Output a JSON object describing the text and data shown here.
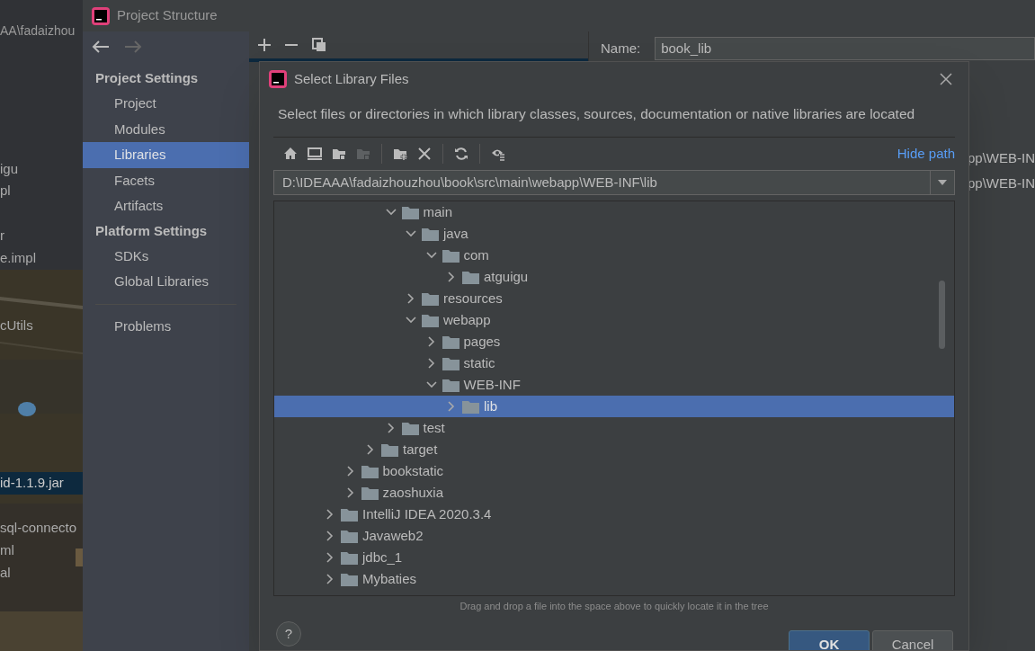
{
  "background_ide": {
    "path_text": "AA\\fadaizhou",
    "items": [
      {
        "label": "igu",
        "selected": false
      },
      {
        "label": "pl",
        "selected": false
      },
      {
        "label": "r",
        "selected": false
      },
      {
        "label": "e.impl",
        "selected": false
      },
      {
        "label": "cUtils",
        "selected": false
      },
      {
        "label": "id-1.1.9.jar",
        "selected": true
      },
      {
        "label": "sql-connecto",
        "selected": false
      },
      {
        "label": "ml",
        "selected": false
      },
      {
        "label": "al",
        "selected": false
      }
    ]
  },
  "window": {
    "title": "Project Structure"
  },
  "sidebar": {
    "sections": [
      {
        "header": "Project Settings",
        "items": [
          {
            "label": "Project",
            "selected": false
          },
          {
            "label": "Modules",
            "selected": false
          },
          {
            "label": "Libraries",
            "selected": true
          },
          {
            "label": "Facets",
            "selected": false
          },
          {
            "label": "Artifacts",
            "selected": false
          }
        ]
      },
      {
        "header": "Platform Settings",
        "items": [
          {
            "label": "SDKs",
            "selected": false
          },
          {
            "label": "Global Libraries",
            "selected": false
          }
        ]
      },
      {
        "items": [
          {
            "label": "Problems",
            "selected": false
          }
        ]
      }
    ]
  },
  "library_panel": {
    "name_label": "Name:",
    "name_value": "book_lib",
    "paths": [
      "pp\\WEB-IN",
      "pp\\WEB-IN"
    ]
  },
  "dialog": {
    "title": "Select Library Files",
    "description": "Select files or directories in which library classes, sources, documentation or native libraries are located",
    "toolbar": [
      {
        "kind": "home",
        "disabled": false
      },
      {
        "kind": "desktop",
        "disabled": false
      },
      {
        "kind": "project",
        "disabled": false
      },
      {
        "kind": "module",
        "disabled": true
      },
      {
        "kind": "separator"
      },
      {
        "kind": "new-folder",
        "disabled": false
      },
      {
        "kind": "delete",
        "disabled": false
      },
      {
        "kind": "separator"
      },
      {
        "kind": "refresh",
        "disabled": false
      },
      {
        "kind": "separator"
      },
      {
        "kind": "show-hidden",
        "disabled": false
      }
    ],
    "hide_path_link": "Hide path",
    "path": "D:\\IDEAAA\\fadaizhouzhou\\book\\src\\main\\webapp\\WEB-INF\\lib",
    "tree": [
      {
        "children": [
          {
            "children": [
              {
                "children": [
                  {
                    "label": "main",
                    "expanded": true,
                    "selected": false,
                    "children": [
                      {
                        "label": "java",
                        "expanded": true,
                        "selected": false,
                        "children": [
                          {
                            "label": "com",
                            "expanded": true,
                            "selected": false,
                            "children": [
                              {
                                "label": "atguigu",
                                "expanded": false,
                                "selected": false
                              }
                            ]
                          }
                        ]
                      },
                      {
                        "label": "resources",
                        "expanded": false,
                        "selected": false
                      },
                      {
                        "label": "webapp",
                        "expanded": true,
                        "selected": false,
                        "children": [
                          {
                            "label": "pages",
                            "expanded": false,
                            "selected": false
                          },
                          {
                            "label": "static",
                            "expanded": false,
                            "selected": false
                          },
                          {
                            "label": "WEB-INF",
                            "expanded": true,
                            "selected": false,
                            "children": [
                              {
                                "label": "lib",
                                "expanded": false,
                                "selected": true
                              }
                            ]
                          }
                        ]
                      }
                    ]
                  },
                  {
                    "label": "test",
                    "expanded": false,
                    "selected": false
                  }
                ]
              },
              {
                "label": "target",
                "expanded": false,
                "selected": false
              }
            ]
          },
          {
            "label": "bookstatic",
            "expanded": false,
            "selected": false
          },
          {
            "label": "zaoshuxia",
            "expanded": false,
            "selected": false
          }
        ]
      },
      {
        "label": "IntelliJ IDEA 2020.3.4",
        "expanded": false,
        "selected": false
      },
      {
        "label": "Javaweb2",
        "expanded": false,
        "selected": false
      },
      {
        "label": "jdbc_1",
        "expanded": false,
        "selected": false
      },
      {
        "label": "Mybaties",
        "expanded": false,
        "selected": false
      }
    ],
    "hint": "Drag and drop a file into the space above to quickly locate it in the tree",
    "help_button": "?",
    "buttons": [
      {
        "label": "OK",
        "default": true
      },
      {
        "label": "Cancel",
        "default": false
      }
    ]
  }
}
